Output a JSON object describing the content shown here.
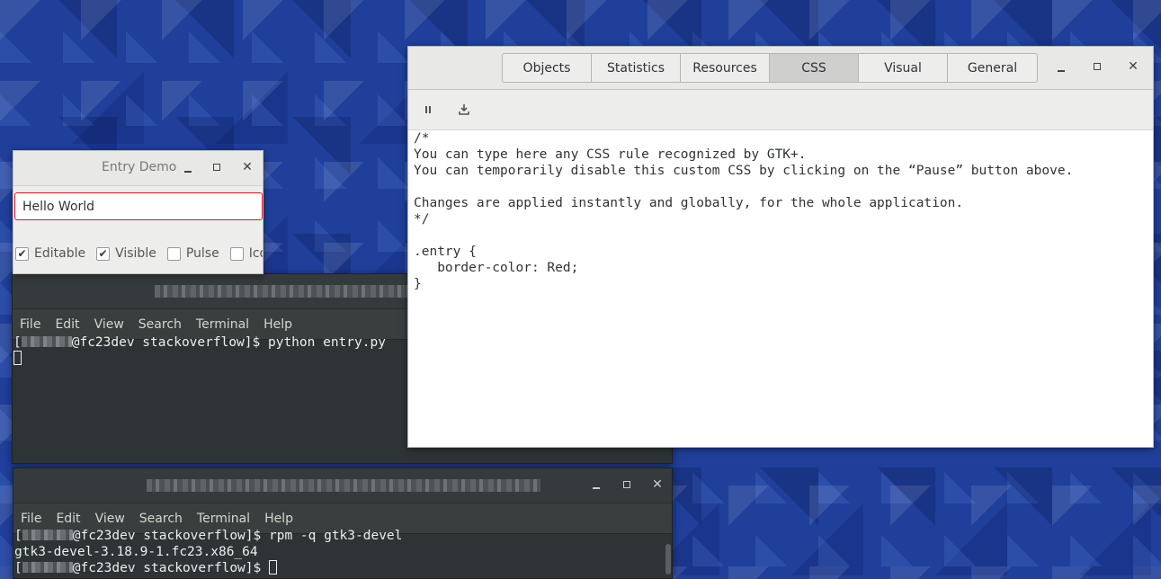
{
  "inspector": {
    "tabs": [
      "Objects",
      "Statistics",
      "Resources",
      "CSS",
      "Visual",
      "General"
    ],
    "active_tab": "CSS",
    "css_text": "/*\nYou can type here any CSS rule recognized by GTK+.\nYou can temporarily disable this custom CSS by clicking on the “Pause” button above.\n\nChanges are applied instantly and globally, for the whole application.\n*/\n\n.entry {\n   border-color: Red;\n}"
  },
  "entry_demo": {
    "title": "Entry Demo",
    "entry_value": "Hello World",
    "checkboxes": [
      {
        "label": "Editable",
        "checked": true
      },
      {
        "label": "Visible",
        "checked": true
      },
      {
        "label": "Pulse",
        "checked": false
      },
      {
        "label": "Icon",
        "checked": false
      }
    ]
  },
  "terminal_menu": [
    "File",
    "Edit",
    "View",
    "Search",
    "Terminal",
    "Help"
  ],
  "terminal1": {
    "prompt_suffix": "@fc23dev stackoverflow]$ ",
    "command": "python entry.py"
  },
  "terminal2": {
    "prompt_suffix": "@fc23dev stackoverflow]$ ",
    "command": "rpm -q gtk3-devel",
    "output": "gtk3-devel-3.18.9-1.fc23.x86_64"
  }
}
